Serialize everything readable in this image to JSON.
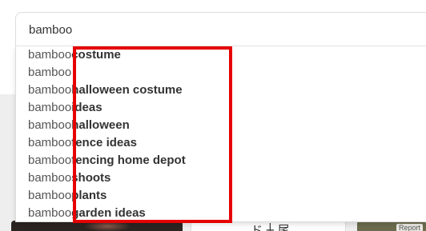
{
  "search": {
    "value": "bamboo",
    "placeholder": ""
  },
  "suggestions": [
    {
      "typed": "bamboo",
      "completion": "costume"
    },
    {
      "typed": "bamboo",
      "completion": ""
    },
    {
      "typed": "bamboo",
      "completion": "halloween costume"
    },
    {
      "typed": "bamboo",
      "completion": "ideas"
    },
    {
      "typed": "bamboo",
      "completion": "halloween"
    },
    {
      "typed": "bamboo",
      "completion": "fence ideas"
    },
    {
      "typed": "bamboo",
      "completion": "fencing home depot"
    },
    {
      "typed": "bamboo",
      "completion": "shoots"
    },
    {
      "typed": "bamboo",
      "completion": "plants"
    },
    {
      "typed": "bamboo",
      "completion": "garden ideas"
    }
  ],
  "background": {
    "report_label": "Report"
  },
  "colors": {
    "highlight": "#e60000",
    "text": "#333333"
  }
}
